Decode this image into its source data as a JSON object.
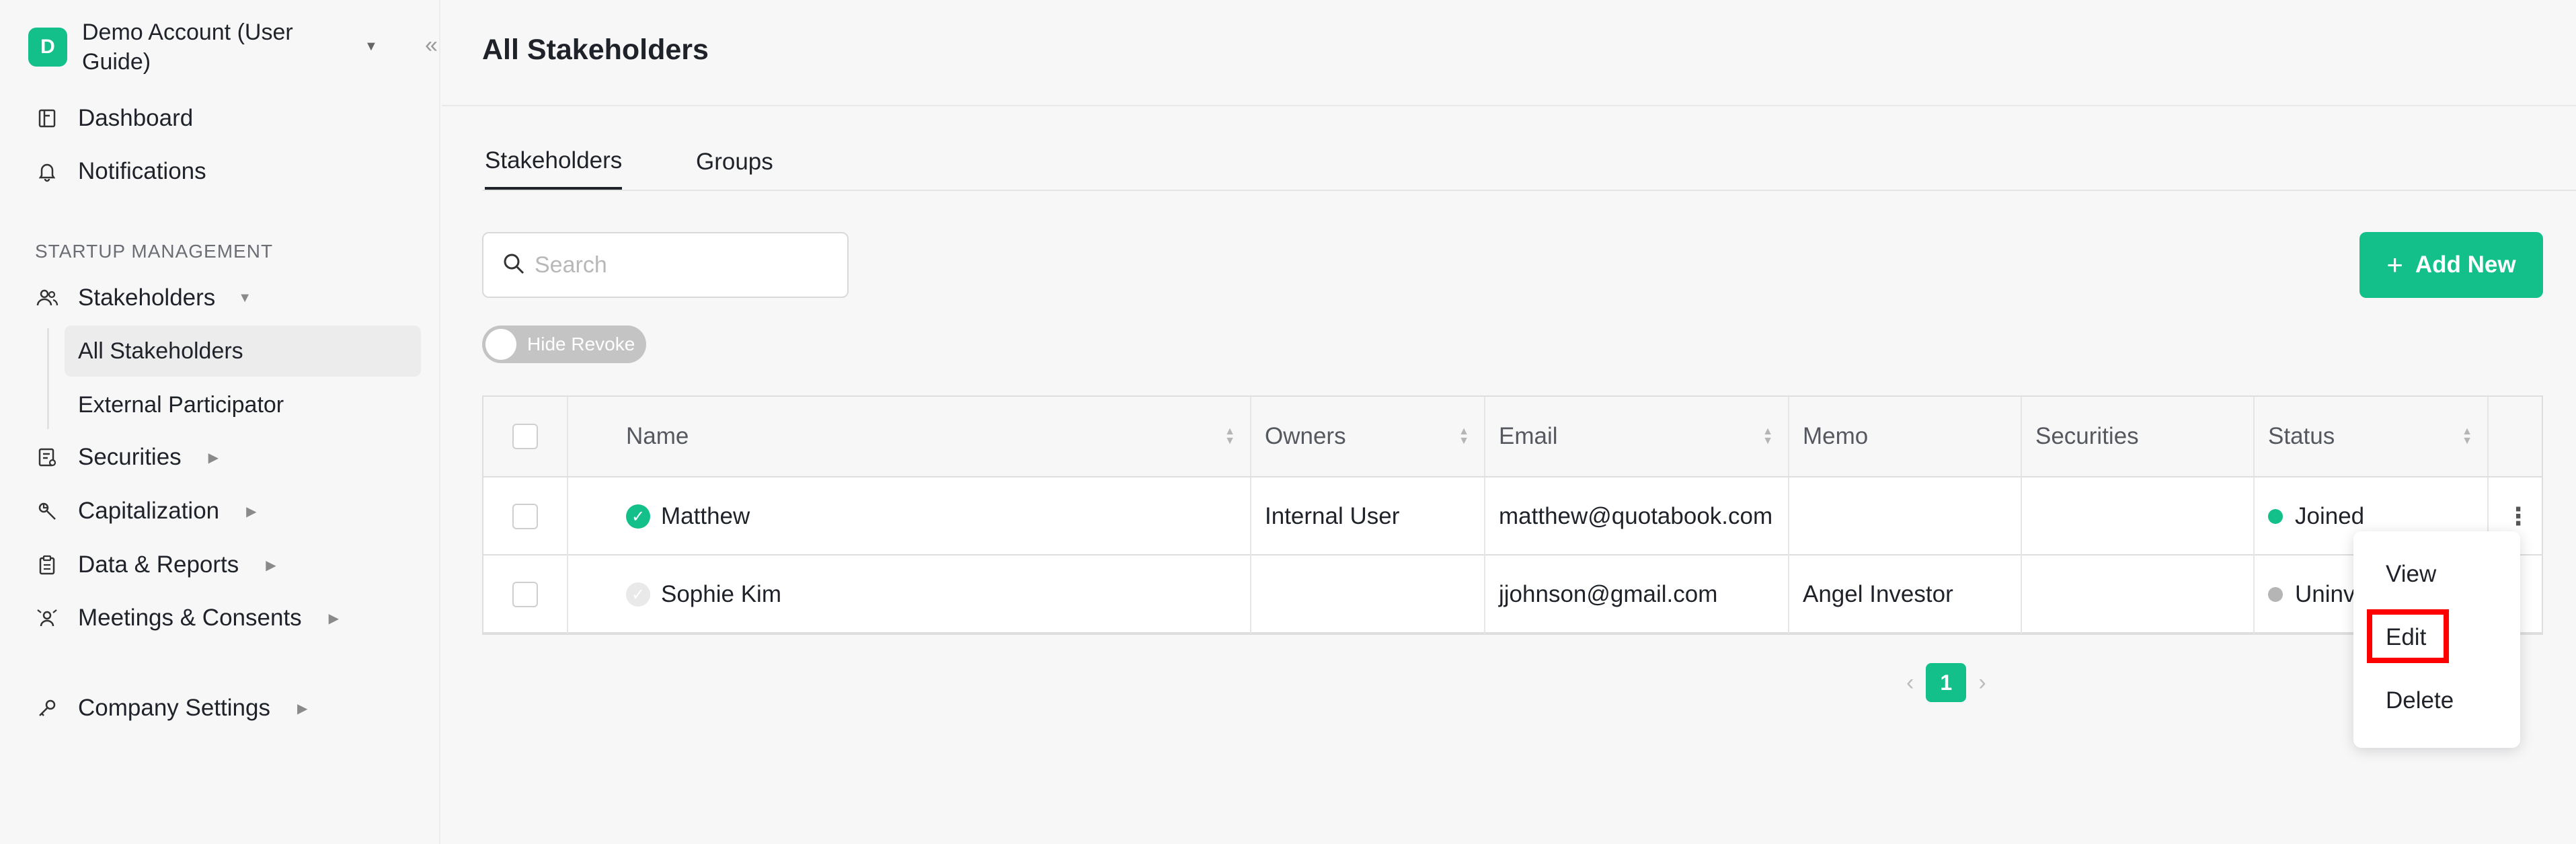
{
  "account": {
    "initial": "D",
    "name": "Demo Account (User Guide)"
  },
  "sidebar": {
    "top_items": [
      {
        "label": "Dashboard"
      },
      {
        "label": "Notifications"
      }
    ],
    "section_title": "STARTUP MANAGEMENT",
    "stakeholders": {
      "label": "Stakeholders",
      "sub_items": [
        "All Stakeholders",
        "External Participator"
      ]
    },
    "items": [
      {
        "label": "Securities"
      },
      {
        "label": "Capitalization"
      },
      {
        "label": "Data & Reports"
      },
      {
        "label": "Meetings & Consents"
      }
    ],
    "settings": {
      "label": "Company Settings"
    }
  },
  "main": {
    "title": "All Stakeholders",
    "tabs": [
      {
        "label": "Stakeholders"
      },
      {
        "label": "Groups"
      }
    ],
    "search": {
      "placeholder": "Search",
      "value": ""
    },
    "add_button": "Add New",
    "toggle_label": "Hide Revoke"
  },
  "table": {
    "headers": [
      "Name",
      "Owners",
      "Email",
      "Memo",
      "Securities",
      "Status"
    ],
    "rows": [
      {
        "name": "Matthew",
        "owners": "Internal User",
        "email": "matthew@quotabook.com",
        "memo": "",
        "securities": "",
        "status": "Joined",
        "status_color": "#14c08a"
      },
      {
        "name": "Sophie Kim",
        "owners": "",
        "email": "jjohnson@gmail.com",
        "memo": "Angel Investor",
        "securities": "",
        "status": "Uninvit",
        "status_color": "#b5b5b5"
      }
    ]
  },
  "pagination": {
    "current": "1"
  },
  "context_menu": {
    "items": [
      "View",
      "Edit",
      "Delete"
    ]
  },
  "colors": {
    "accent": "#14c08a",
    "highlight": "#ff0000"
  }
}
